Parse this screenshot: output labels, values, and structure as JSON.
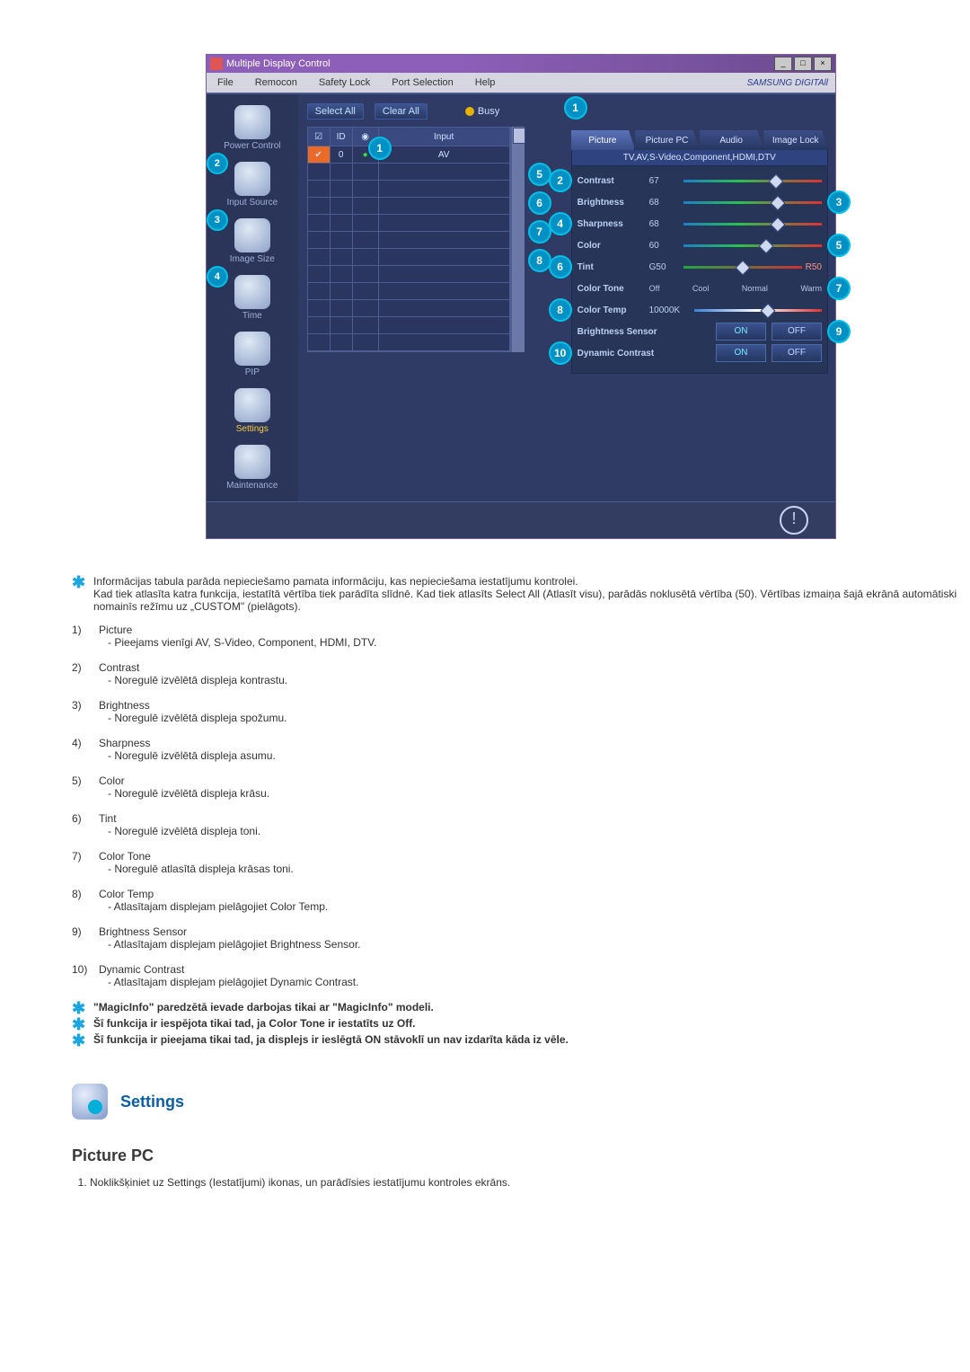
{
  "window": {
    "title": "Multiple Display Control",
    "menus": [
      "File",
      "Remocon",
      "Safety Lock",
      "Port Selection",
      "Help"
    ],
    "brand": "SAMSUNG DIGITAll"
  },
  "sidebar": {
    "items": [
      {
        "label": "Power Control"
      },
      {
        "label": "Input Source",
        "marker": "2"
      },
      {
        "label": "Image Size",
        "marker": "3"
      },
      {
        "label": "Time",
        "marker": "4"
      },
      {
        "label": "PIP"
      },
      {
        "label": "Settings",
        "active": true
      },
      {
        "label": "Maintenance"
      }
    ]
  },
  "toolbar": {
    "selectAll": "Select All",
    "clearAll": "Clear All",
    "busy": "Busy",
    "busyMarker": "1"
  },
  "grid": {
    "headers": {
      "chk": "",
      "id": "ID",
      "stat": "",
      "input": "Input"
    },
    "rows": [
      {
        "id": "0",
        "sel": true,
        "input": "AV"
      },
      {
        "id": ""
      },
      {
        "id": ""
      },
      {
        "id": ""
      },
      {
        "id": ""
      },
      {
        "id": ""
      },
      {
        "id": ""
      },
      {
        "id": ""
      },
      {
        "id": ""
      },
      {
        "id": ""
      },
      {
        "id": ""
      },
      {
        "id": ""
      }
    ],
    "rowMarkers": [
      "5",
      "6",
      "7",
      "8"
    ]
  },
  "tabs": {
    "items": [
      "Picture",
      "Picture PC",
      "Audio",
      "Image Lock"
    ],
    "active": 0,
    "topMarker": "1",
    "subhead": "TV,AV,S-Video,Component,HDMI,DTV"
  },
  "controls": {
    "contrast": {
      "label": "Contrast",
      "val": "67",
      "marker_pre": "2"
    },
    "brightness": {
      "label": "Brightness",
      "val": "68",
      "marker_post": "3"
    },
    "sharpness": {
      "label": "Sharpness",
      "val": "68",
      "marker_pre": "4"
    },
    "color": {
      "label": "Color",
      "val": "60",
      "marker_post": "5"
    },
    "tint": {
      "label": "Tint",
      "val": "G50",
      "marker_pre": "6",
      "right": "R50"
    },
    "colorTone": {
      "label": "Color Tone",
      "opts": [
        "Off",
        "Cool",
        "Normal",
        "Warm"
      ],
      "marker_post": "7"
    },
    "colorTemp": {
      "label": "Color Temp",
      "val": "10000K",
      "marker_pre": "8"
    },
    "brightSensor": {
      "label": "Brightness Sensor",
      "on": "ON",
      "off": "OFF",
      "marker_post": "9"
    },
    "dynContrast": {
      "label": "Dynamic Contrast",
      "on": "ON",
      "off": "OFF",
      "marker_pre": "10"
    }
  },
  "notes": {
    "intro": "Informācijas tabula parāda nepieciešamo pamata informāciju, kas nepieciešama iestatījumu kontrolei.\nKad tiek atlasīta katra funkcija, iestatītā vērtība tiek parādīta slīdnē. Kad tiek atlasīts Select All (Atlasīt visu), parādās noklusētā vērtība (50). Vērtības izmaiņa šajā ekrānā automātiski nomainīs režīmu uz „CUSTOM\" (pielāgots).",
    "list": [
      {
        "n": "1)",
        "t": "Picture",
        "d": "Pieejams vienīgi AV, S-Video, Component, HDMI, DTV."
      },
      {
        "n": "2)",
        "t": "Contrast",
        "d": "Noregulē izvēlētā displeja kontrastu."
      },
      {
        "n": "3)",
        "t": "Brightness",
        "d": "Noregulē izvēlētā displeja spožumu."
      },
      {
        "n": "4)",
        "t": "Sharpness",
        "d": "Noregulē izvēlētā displeja asumu."
      },
      {
        "n": "5)",
        "t": "Color",
        "d": "Noregulē izvēlētā displeja krāsu."
      },
      {
        "n": "6)",
        "t": "Tint",
        "d": "Noregulē izvēlētā displeja toni."
      },
      {
        "n": "7)",
        "t": "Color Tone",
        "d": "Noregulē atlasītā displeja krāsas toni."
      },
      {
        "n": "8)",
        "t": "Color Temp",
        "d": "Atlasītajam displejam pielāgojiet Color Temp."
      },
      {
        "n": "9)",
        "t": "Brightness Sensor",
        "d": "Atlasītajam displejam pielāgojiet Brightness Sensor."
      },
      {
        "n": "10)",
        "t": "Dynamic Contrast",
        "d": "Atlasītajam displejam pielāgojiet Dynamic Contrast."
      }
    ],
    "stars": [
      "\"MagicInfo\" paredzētā ievade darbojas tikai ar \"MagicInfo\" modeli.",
      "Šī funkcija ir iespējota tikai tad, ja Color Tone ir iestatīts uz Off.",
      "Šī funkcija ir pieejama tikai tad, ja displejs ir ieslēgtā ON stāvoklī un nav izdarīta kāda iz vēle."
    ]
  },
  "section": {
    "title": "Settings",
    "sub": "Picture PC",
    "step1": "Noklikšķiniet uz Settings (Iestatījumi) ikonas, un parādīsies iestatījumu kontroles ekrāns."
  }
}
